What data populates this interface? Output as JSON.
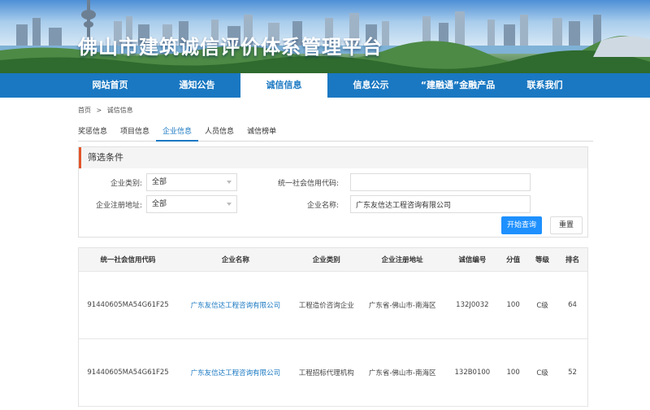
{
  "site": {
    "title": "佛山市建筑诚信评价体系管理平台"
  },
  "nav": {
    "items": [
      {
        "label": "网站首页"
      },
      {
        "label": "通知公告"
      },
      {
        "label": "诚信信息"
      },
      {
        "label": "信息公示"
      },
      {
        "label": "“建融通”金融产品"
      },
      {
        "label": "联系我们"
      }
    ],
    "active_index": 2
  },
  "breadcrumb": {
    "home": "首页",
    "separator": ">",
    "current": "诚信信息"
  },
  "tabs": {
    "items": [
      {
        "label": "奖惩信息"
      },
      {
        "label": "项目信息"
      },
      {
        "label": "企业信息"
      },
      {
        "label": "人员信息"
      },
      {
        "label": "诚信榜单"
      }
    ],
    "active_index": 2
  },
  "filter": {
    "title": "筛选条件",
    "category_label": "企业类别:",
    "category_value": "全部",
    "address_label": "企业注册地址:",
    "address_value": "全部",
    "credit_code_label": "统一社会信用代码:",
    "credit_code_value": "",
    "name_label": "企业名称:",
    "name_value": "广东友信达工程咨询有限公司",
    "search_button": "开始查询",
    "reset_button": "重置"
  },
  "table": {
    "columns": [
      "统一社会信用代码",
      "企业名称",
      "企业类别",
      "企业注册地址",
      "诚信编号",
      "分值",
      "等级",
      "排名"
    ],
    "rows": [
      [
        "91440605MA54G61F25",
        "广东友信达工程咨询有限公司",
        "工程造价咨询企业",
        "广东省-佛山市-南海区",
        "132J0032",
        "100",
        "C级",
        "64"
      ],
      [
        "91440605MA54G61F25",
        "广东友信达工程咨询有限公司",
        "工程招标代理机构",
        "广东省-佛山市-南海区",
        "132B0100",
        "100",
        "C级",
        "52"
      ]
    ]
  },
  "colors": {
    "nav_blue": "#1a78c2",
    "button_blue": "#1e90ff",
    "accent_orange": "#e2552b"
  }
}
